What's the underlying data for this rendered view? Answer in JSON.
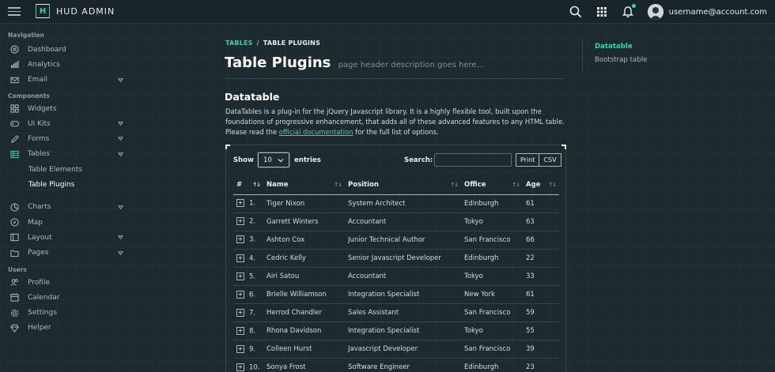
{
  "app": {
    "logo_letter": "H",
    "name": "HUD ADMIN"
  },
  "header": {
    "username": "username@account.com"
  },
  "sidebar": {
    "sections": [
      {
        "label": "Navigation",
        "items": [
          {
            "label": "Dashboard",
            "icon": "gauge-icon"
          },
          {
            "label": "Analytics",
            "icon": "bar-chart-icon"
          },
          {
            "label": "Email",
            "icon": "envelope-icon",
            "has_caret": true
          }
        ]
      },
      {
        "label": "Components",
        "items": [
          {
            "label": "Widgets",
            "icon": "widgets-icon"
          },
          {
            "label": "UI Kits",
            "icon": "gamepad-icon",
            "has_caret": true
          },
          {
            "label": "Forms",
            "icon": "pen-icon",
            "has_caret": true
          },
          {
            "label": "Tables",
            "icon": "grid-icon",
            "has_caret": true,
            "expanded": true,
            "children": [
              {
                "label": "Table Elements"
              },
              {
                "label": "Table Plugins",
                "active": true
              }
            ]
          },
          {
            "label": "Charts",
            "icon": "pie-chart-icon",
            "has_caret": true
          },
          {
            "label": "Map",
            "icon": "compass-icon"
          },
          {
            "label": "Layout",
            "icon": "layout-icon",
            "has_caret": true
          },
          {
            "label": "Pages",
            "icon": "folder-icon",
            "has_caret": true
          }
        ]
      },
      {
        "label": "Users",
        "items": [
          {
            "label": "Profile",
            "icon": "users-icon"
          },
          {
            "label": "Calendar",
            "icon": "calendar-icon"
          },
          {
            "label": "Settings",
            "icon": "gear-icon"
          },
          {
            "label": "Helper",
            "icon": "gem-icon"
          }
        ]
      }
    ]
  },
  "breadcrumb": {
    "parent": "TABLES",
    "separator": "/",
    "current": "TABLE PLUGINS"
  },
  "page": {
    "title": "Table Plugins",
    "subtitle": "page header description goes here..."
  },
  "datatable_section": {
    "title": "Datatable",
    "desc_before": "DataTables is a plug-in for the jQuery Javascript library. It is a highly flexible tool, built upon the foundations of progressive enhancement, that adds all of these advanced features to any HTML table. Please read the ",
    "desc_link": "official documentation",
    "desc_after": " for the full list of options."
  },
  "controls": {
    "show_label": "Show",
    "length_value": "10",
    "entries_label": "entries",
    "search_label": "Search:",
    "search_value": "",
    "buttons": [
      "Print",
      "CSV"
    ]
  },
  "table": {
    "columns": [
      "#",
      "Name",
      "Position",
      "Office",
      "Age"
    ],
    "rows": [
      [
        "1.",
        "Tiger Nixon",
        "System Architect",
        "Edinburgh",
        "61"
      ],
      [
        "2.",
        "Garrett Winters",
        "Accountant",
        "Tokyo",
        "63"
      ],
      [
        "3.",
        "Ashton Cox",
        "Junior Technical Author",
        "San Francisco",
        "66"
      ],
      [
        "4.",
        "Cedric Kelly",
        "Senior Javascript Developer",
        "Edinburgh",
        "22"
      ],
      [
        "5.",
        "Airi Satou",
        "Accountant",
        "Tokyo",
        "33"
      ],
      [
        "6.",
        "Brielle Williamson",
        "Integration Specialist",
        "New York",
        "61"
      ],
      [
        "7.",
        "Herrod Chandler",
        "Sales Assistant",
        "San Francisco",
        "59"
      ],
      [
        "8.",
        "Rhona Davidson",
        "Integration Specialist",
        "Tokyo",
        "55"
      ],
      [
        "9.",
        "Colleen Hurst",
        "Javascript Developer",
        "San Francisco",
        "39"
      ],
      [
        "10.",
        "Sonya Frost",
        "Software Engineer",
        "Edinburgh",
        "23"
      ]
    ]
  },
  "right_nav": {
    "items": [
      {
        "label": "Datatable",
        "active": true
      },
      {
        "label": "Bootstrap table"
      }
    ]
  },
  "colors": {
    "accent": "#3cd2a5",
    "background": "#1d2a30",
    "topbar": "#1a252b"
  }
}
